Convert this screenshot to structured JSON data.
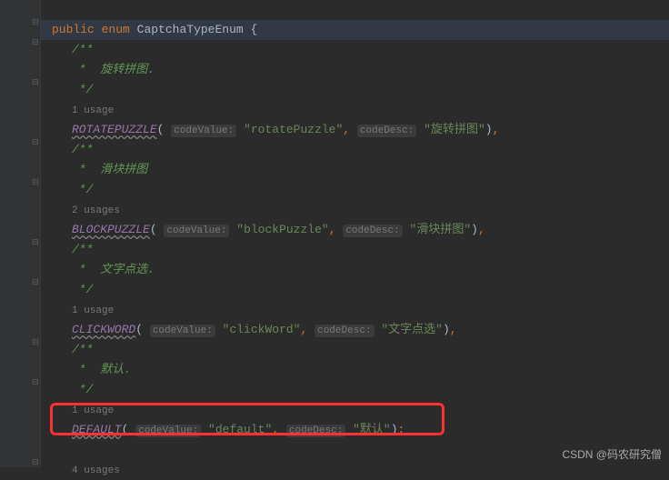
{
  "declaration": {
    "public": "public",
    "enum": "enum",
    "class_name": "CaptchaTypeEnum",
    "open_brace": "{"
  },
  "comments": {
    "open": "/**",
    "rotate": " *  旋转拼图.",
    "block": " *  滑块拼图",
    "click": " *  文字点选.",
    "default": " *  默认.",
    "close": " */"
  },
  "usages": {
    "one": "1 usage",
    "two": "2 usages",
    "four": "4 usages"
  },
  "hints": {
    "codeValue": "codeValue:",
    "codeDesc": "codeDesc:"
  },
  "enums": {
    "rotate": {
      "name": "ROTATEPUZZLE",
      "value": "\"rotatePuzzle\"",
      "desc": "\"旋转拼图\""
    },
    "block": {
      "name": "BLOCKPUZZLE",
      "value": "\"blockPuzzle\"",
      "desc": "\"滑块拼图\""
    },
    "click": {
      "name": "CLICKWORD",
      "value": "\"clickWord\"",
      "desc": "\"文字点选\""
    },
    "default": {
      "name": "DEFAULT",
      "value": "\"default\"",
      "desc": "\"默认\""
    }
  },
  "watermark": "CSDN @码农研究僧"
}
